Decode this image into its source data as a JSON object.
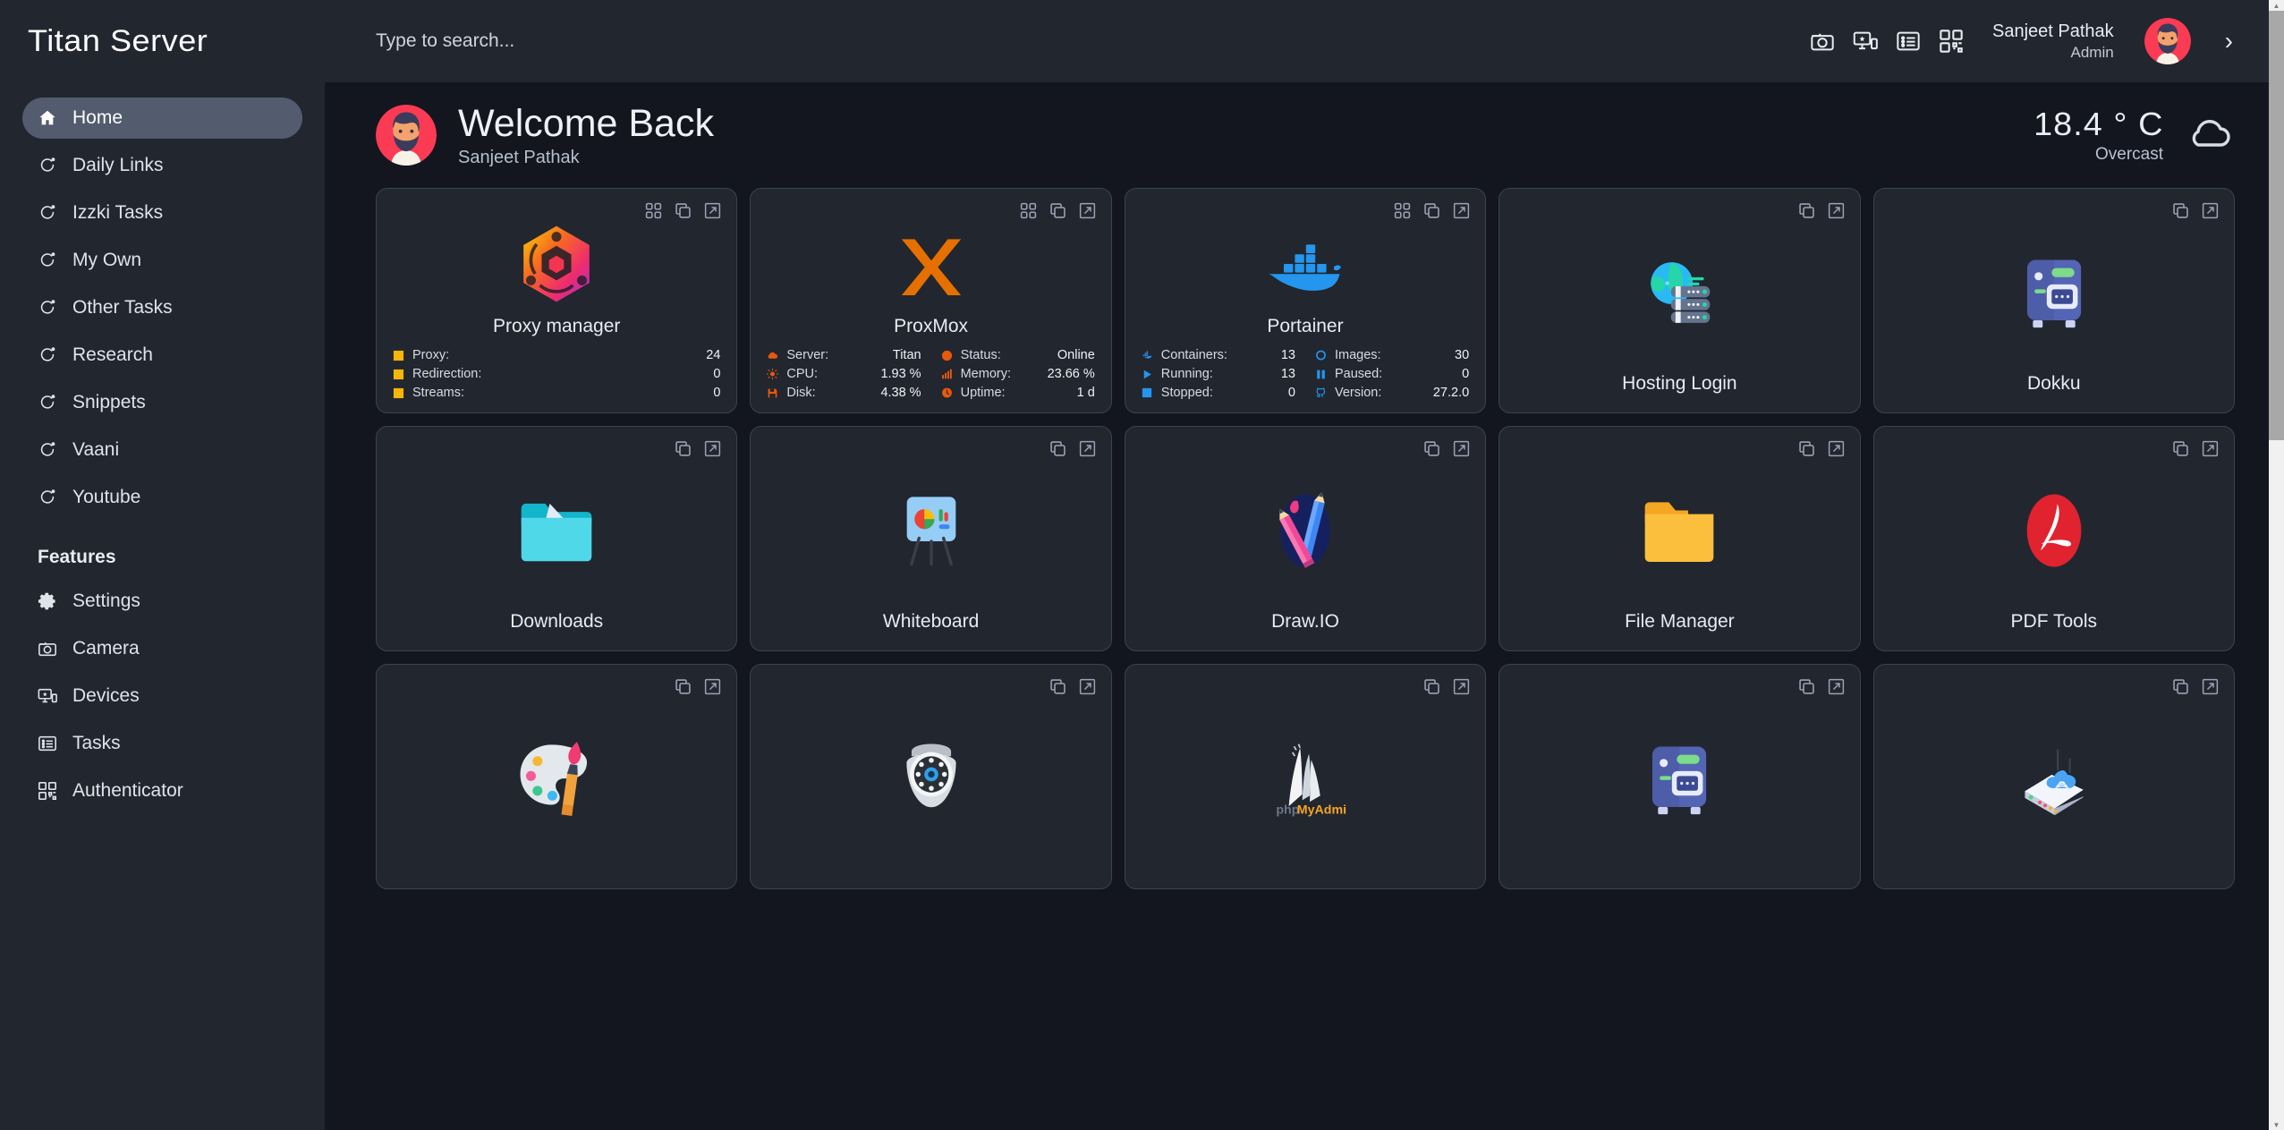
{
  "brand": {
    "title": "Titan Server"
  },
  "search": {
    "placeholder": "Type to search...",
    "value": ""
  },
  "header": {
    "icons": [
      "camera-icon",
      "devices-icon",
      "tasks-icon",
      "qr-code-icon"
    ],
    "user_name": "Sanjeet Pathak",
    "user_role": "Admin",
    "avatar": "avatar-sanjeet",
    "chevron": "›"
  },
  "sidebar": {
    "items": [
      {
        "label": "Home",
        "icon": "home-icon",
        "active": true
      },
      {
        "label": "Daily Links",
        "icon": "bookmark-refresh-icon",
        "active": false
      },
      {
        "label": "Izzki Tasks",
        "icon": "bookmark-refresh-icon",
        "active": false
      },
      {
        "label": "My Own",
        "icon": "bookmark-refresh-icon",
        "active": false
      },
      {
        "label": "Other Tasks",
        "icon": "bookmark-refresh-icon",
        "active": false
      },
      {
        "label": "Research",
        "icon": "bookmark-refresh-icon",
        "active": false
      },
      {
        "label": "Snippets",
        "icon": "bookmark-refresh-icon",
        "active": false
      },
      {
        "label": "Vaani",
        "icon": "bookmark-refresh-icon",
        "active": false
      },
      {
        "label": "Youtube",
        "icon": "bookmark-refresh-icon",
        "active": false
      }
    ],
    "section_title": "Features",
    "features": [
      {
        "label": "Settings",
        "icon": "gear-icon"
      },
      {
        "label": "Camera",
        "icon": "camera-icon"
      },
      {
        "label": "Devices",
        "icon": "devices-icon"
      },
      {
        "label": "Tasks",
        "icon": "tasks-icon"
      },
      {
        "label": "Authenticator",
        "icon": "qr-code-icon"
      }
    ]
  },
  "welcome": {
    "title": "Welcome Back",
    "subtitle": "Sanjeet Pathak",
    "weather_temp": "18.4 ° C",
    "weather_desc": "Overcast",
    "weather_icon": "cloud-icon"
  },
  "colors": {
    "page_bg": "#13161f",
    "panel_bg": "#22262f",
    "card_border": "#3b4252",
    "active_nav": "#525c6e",
    "accent_yellow": "#f5b50a",
    "accent_orange": "#e8590c",
    "accent_blue": "#2496ed",
    "text_primary": "#e7ebf2",
    "text_muted": "#b7bfcd"
  },
  "cards": [
    {
      "title": "Proxy manager",
      "logo": "nginx-proxy-manager-logo",
      "actions": [
        "grid-icon",
        "copy-icon",
        "external-link-icon"
      ],
      "stats_columns": 1,
      "stats": [
        {
          "icon": "square-icon",
          "color": "#f5b50a",
          "label": "Proxy:",
          "value": "24"
        },
        {
          "icon": "square-icon",
          "color": "#f5b50a",
          "label": "Redirection:",
          "value": "0"
        },
        {
          "icon": "square-icon",
          "color": "#f5b50a",
          "label": "Streams:",
          "value": "0"
        }
      ]
    },
    {
      "title": "ProxMox",
      "logo": "proxmox-logo",
      "actions": [
        "grid-icon",
        "copy-icon",
        "external-link-icon"
      ],
      "stats_columns": 2,
      "stats": [
        {
          "icon": "cloud-icon",
          "color": "#e8590c",
          "label": "Server:",
          "value": "Titan"
        },
        {
          "icon": "cpu-icon",
          "color": "#e8590c",
          "label": "Status:",
          "value": "Online"
        },
        {
          "icon": "sun-icon",
          "color": "#e8590c",
          "label": "CPU:",
          "value": "1.93 %"
        },
        {
          "icon": "bars-icon",
          "color": "#e8590c",
          "label": "Memory:",
          "value": "23.66 %"
        },
        {
          "icon": "disk-icon",
          "color": "#e8590c",
          "label": "Disk:",
          "value": "4.38 %"
        },
        {
          "icon": "clock-icon",
          "color": "#e8590c",
          "label": "Uptime:",
          "value": "1 d"
        }
      ]
    },
    {
      "title": "Portainer",
      "logo": "docker-logo",
      "actions": [
        "grid-icon",
        "copy-icon",
        "external-link-icon"
      ],
      "stats_columns": 2,
      "stats": [
        {
          "icon": "docker-icon",
          "color": "#2496ed",
          "label": "Containers:",
          "value": "13"
        },
        {
          "icon": "circle-outline-icon",
          "color": "#2496ed",
          "label": "Images:",
          "value": "30"
        },
        {
          "icon": "play-icon",
          "color": "#2496ed",
          "label": "Running:",
          "value": "13"
        },
        {
          "icon": "pause-icon",
          "color": "#2496ed",
          "label": "Paused:",
          "value": "0"
        },
        {
          "icon": "stop-icon",
          "color": "#2496ed",
          "label": "Stopped:",
          "value": "0"
        },
        {
          "icon": "github-icon",
          "color": "#2496ed",
          "label": "Version:",
          "value": "27.2.0"
        }
      ]
    },
    {
      "title": "Hosting Login",
      "logo": "globe-server-logo",
      "actions": [
        "copy-icon",
        "external-link-icon"
      ],
      "stats_columns": 0,
      "stats": []
    },
    {
      "title": "Dokku",
      "logo": "dokku-server-logo",
      "actions": [
        "copy-icon",
        "external-link-icon"
      ],
      "stats_columns": 0,
      "stats": []
    },
    {
      "title": "Downloads",
      "logo": "downloads-folder-logo",
      "actions": [
        "copy-icon",
        "external-link-icon"
      ],
      "stats_columns": 0,
      "stats": []
    },
    {
      "title": "Whiteboard",
      "logo": "whiteboard-easel-logo",
      "actions": [
        "copy-icon",
        "external-link-icon"
      ],
      "stats_columns": 0,
      "stats": []
    },
    {
      "title": "Draw.IO",
      "logo": "drawio-pencils-logo",
      "actions": [
        "copy-icon",
        "external-link-icon"
      ],
      "stats_columns": 0,
      "stats": []
    },
    {
      "title": "File Manager",
      "logo": "yellow-folder-logo",
      "actions": [
        "copy-icon",
        "external-link-icon"
      ],
      "stats_columns": 0,
      "stats": []
    },
    {
      "title": "PDF Tools",
      "logo": "pdf-acrobat-logo",
      "actions": [
        "copy-icon",
        "external-link-icon"
      ],
      "stats_columns": 0,
      "stats": []
    },
    {
      "title": "",
      "logo": "paint-palette-logo",
      "actions": [
        "copy-icon",
        "external-link-icon"
      ],
      "stats_columns": 0,
      "stats": []
    },
    {
      "title": "",
      "logo": "security-camera-logo",
      "actions": [
        "copy-icon",
        "external-link-icon"
      ],
      "stats_columns": 0,
      "stats": []
    },
    {
      "title": "",
      "logo": "phpmyadmin-logo",
      "actions": [
        "copy-icon",
        "external-link-icon"
      ],
      "stats_columns": 0,
      "stats": []
    },
    {
      "title": "",
      "logo": "dokku-server-logo",
      "actions": [
        "copy-icon",
        "external-link-icon"
      ],
      "stats_columns": 0,
      "stats": []
    },
    {
      "title": "",
      "logo": "router-logo",
      "actions": [
        "copy-icon",
        "external-link-icon"
      ],
      "stats_columns": 0,
      "stats": []
    }
  ]
}
